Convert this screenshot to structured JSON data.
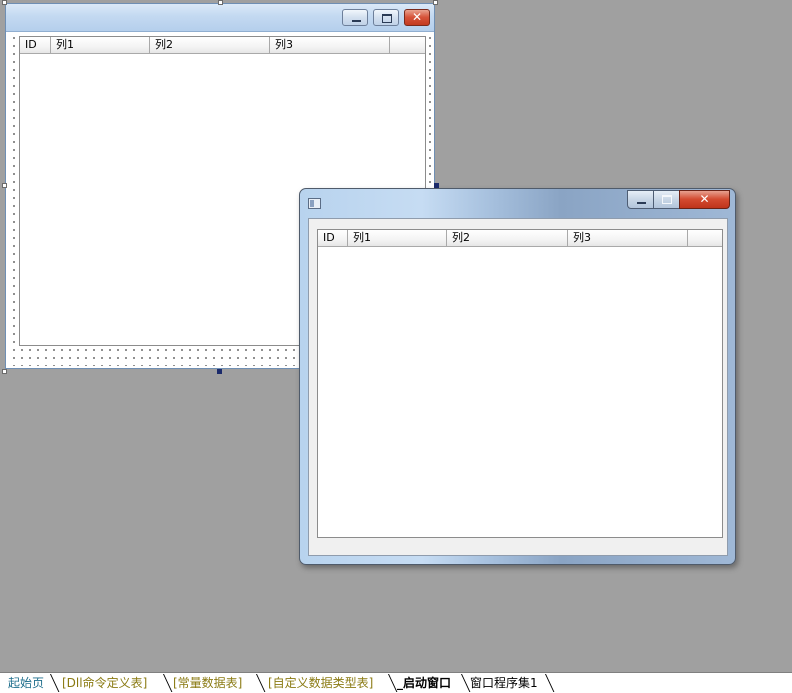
{
  "design_form": {
    "caption_buttons": {
      "minimize_icon": "minimize-icon",
      "maximize_icon": "maximize-icon",
      "close_icon": "close-icon",
      "close_glyph": "✕"
    },
    "listview": {
      "columns": [
        "ID",
        "列1",
        "列2",
        "列3"
      ]
    }
  },
  "runtime_window": {
    "caption_buttons": {
      "minimize_icon": "minimize-icon",
      "maximize_icon": "maximize-icon",
      "close_icon": "close-icon",
      "close_glyph": "✕"
    },
    "listview": {
      "columns": [
        "ID",
        "列1",
        "列2",
        "列3"
      ]
    }
  },
  "tabbar": {
    "tabs": [
      {
        "label": "起始页",
        "color": "#1e6e8c"
      },
      {
        "label": "[Dll命令定义表]",
        "color": "#8a7a12"
      },
      {
        "label": "[常量数据表]",
        "color": "#8a7a12"
      },
      {
        "label": "[自定义数据类型表]",
        "color": "#8a7a12"
      },
      {
        "label": "_启动窗口",
        "color": "#000000",
        "active": true
      },
      {
        "label": "窗口程序集1",
        "color": "#000000"
      }
    ]
  },
  "colors": {
    "workspace_bg": "#a0a0a0",
    "handle_solid": "#1b2a6b"
  }
}
